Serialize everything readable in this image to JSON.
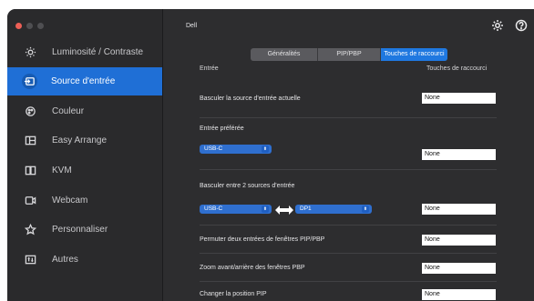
{
  "app": {
    "title": "Dell"
  },
  "sidebar": {
    "items": [
      {
        "label": "Luminosité / Contraste",
        "icon": "sun-icon",
        "active": false
      },
      {
        "label": "Source d'entrée",
        "icon": "input-source-icon",
        "active": true
      },
      {
        "label": "Couleur",
        "icon": "color-icon",
        "active": false
      },
      {
        "label": "Easy Arrange",
        "icon": "layout-icon",
        "active": false
      },
      {
        "label": "KVM",
        "icon": "kvm-icon",
        "active": false
      },
      {
        "label": "Webcam",
        "icon": "webcam-icon",
        "active": false
      },
      {
        "label": "Personnaliser",
        "icon": "star-icon",
        "active": false
      },
      {
        "label": "Autres",
        "icon": "others-icon",
        "active": false
      }
    ]
  },
  "tabs": [
    {
      "label": "Généralités",
      "active": false
    },
    {
      "label": "PIP/PBP",
      "active": false
    },
    {
      "label": "Touches de raccourci",
      "active": true
    }
  ],
  "content": {
    "col_left": "Entrée",
    "col_right": "Touches de raccourci",
    "switch_current": "Basculer la source d'entrée actuelle",
    "preferred_input": "Entrée préférée",
    "preferred_value": "USB-C",
    "switch_two": "Basculer entre 2 sources d'entrée",
    "source_a": "USB-C",
    "source_b": "DP1",
    "swap_pip": "Permuter deux entrées de fenêtres PIP/PBP",
    "zoom_pbp": "Zoom avant/arrière des fenêtres PBP",
    "pip_position": "Changer la position PIP",
    "hotkey_values": [
      "None",
      "None",
      "None",
      "None",
      "None",
      "None"
    ]
  },
  "colors": {
    "accent": "#1f6fd6",
    "background": "#2d2d2f",
    "sidebar": "#2a2a2c"
  }
}
